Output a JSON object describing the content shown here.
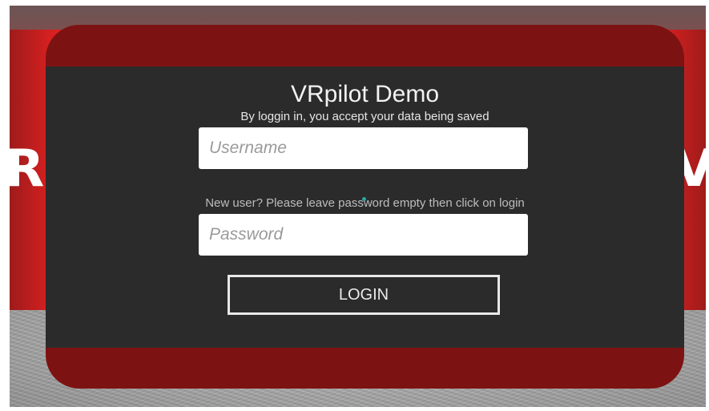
{
  "scene": {
    "wall_left_letters": "RE",
    "wall_right_letters": "OV"
  },
  "login_panel": {
    "title": "VRpilot Demo",
    "subtitle": "By loggin in, you accept your data being saved",
    "username": {
      "placeholder": "Username",
      "value": ""
    },
    "hint": "New user? Please leave password empty then click on login",
    "password": {
      "placeholder": "Password",
      "value": ""
    },
    "login_label": "LOGIN"
  },
  "colors": {
    "panel_frame": "#7d1212",
    "panel_body": "#2b2b2b",
    "wall": "#d82020"
  }
}
